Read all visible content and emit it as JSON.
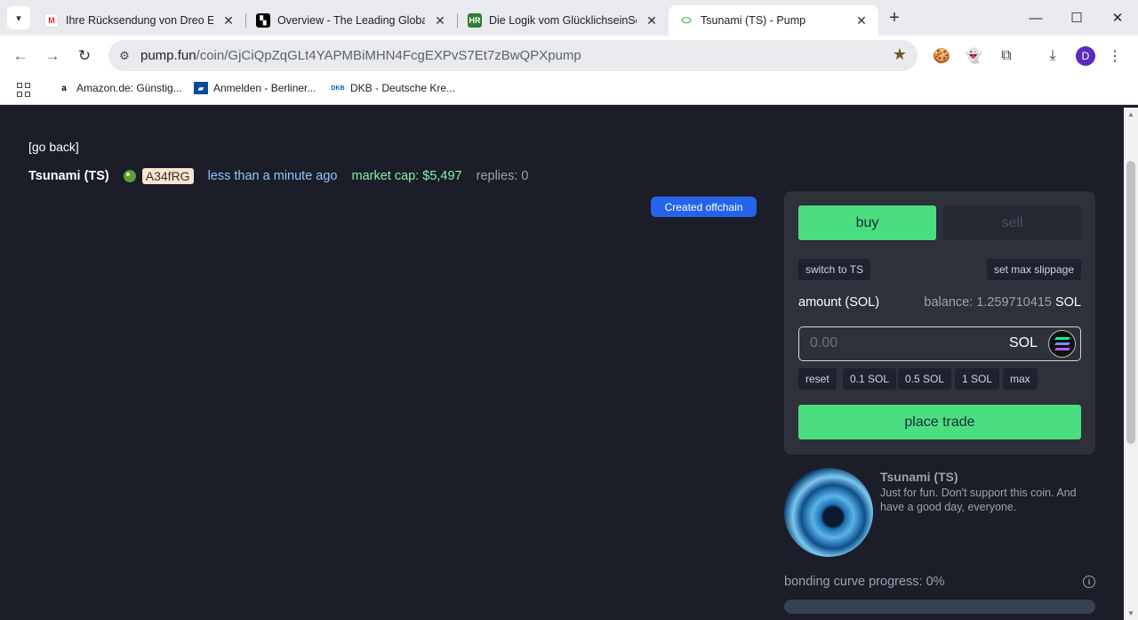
{
  "browser": {
    "tabs": [
      {
        "title": "Ihre Rücksendung von Dreo Eng",
        "icon": "gmail-icon"
      },
      {
        "title": "Overview - The Leading Global",
        "icon": "okx-icon"
      },
      {
        "title": "Die Logik vom GlücklichseinSeit",
        "icon": "hr-icon"
      },
      {
        "title": "Tsunami (TS) - Pump",
        "icon": "pill-icon"
      }
    ],
    "url_domain": "pump.fun",
    "url_path": "/coin/GjCiQpZqGLt4YAPMBiMHN4FcgEXPvS7Et7zBwQPXpump",
    "profile_initial": "D",
    "bookmarks": [
      {
        "label": "Amazon.de: Günstig...",
        "icon": "amazon-icon"
      },
      {
        "label": "Anmelden - Berliner...",
        "icon": "bank-icon"
      },
      {
        "label": "DKB - Deutsche Kre...",
        "icon": "dkb-icon"
      }
    ]
  },
  "page": {
    "go_back": "[go back]",
    "coin_name": "Tsunami (TS)",
    "creator": "A34fRG",
    "time_ago": "less than a minute ago",
    "market_cap": "market cap: $5,497",
    "replies": "replies: 0",
    "offchain_badge": "Created offchain"
  },
  "trade": {
    "buy_label": "buy",
    "sell_label": "sell",
    "switch_label": "switch to TS",
    "slippage_label": "set max slippage",
    "amount_label": "amount (SOL)",
    "balance_prefix": "balance: 1.259710415",
    "balance_unit": "SOL",
    "amount_placeholder": "0.00",
    "currency": "SOL",
    "quick_amounts": [
      "reset",
      "0.1 SOL",
      "0.5 SOL",
      "1 SOL",
      "max"
    ],
    "place_trade_label": "place trade"
  },
  "coin_info": {
    "title": "Tsunami (TS)",
    "description": "Just for fun. Don't support this coin. And have a good day, everyone."
  },
  "bonding": {
    "label": "bonding curve progress: 0%",
    "progress": 0
  }
}
